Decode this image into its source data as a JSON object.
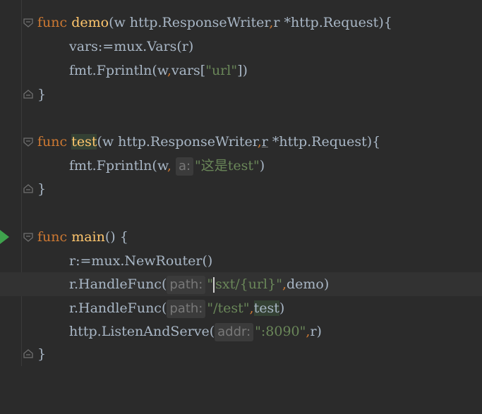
{
  "editor": {
    "lines": {
      "l1": {
        "kw": "func",
        "name": "demo",
        "params_a": "(w http.ResponseWriter",
        "comma": ",",
        "params_b": "r *http.Request){"
      },
      "l2": {
        "text": "vars:=mux.Vars(r)"
      },
      "l3": {
        "pre": "fmt.Fprintln(w",
        "comma": ",",
        "mid": "vars[",
        "str": "\"url\"",
        "post": "])"
      },
      "l4": {
        "text": "}"
      },
      "l6": {
        "kw": "func",
        "name": "test",
        "params_a": "(w http.ResponseWriter",
        "comma": ",",
        "unused": "r",
        "params_b": " *http.Request){"
      },
      "l7": {
        "pre": "fmt.Fprintln(w",
        "comma": ",",
        "hint": "a:",
        "str": "\"这是test\"",
        "post": ")"
      },
      "l8": {
        "text": "}"
      },
      "l10": {
        "kw": "func",
        "name": "main",
        "rest": "() {"
      },
      "l11": {
        "text": "r:=mux.NewRouter()"
      },
      "l12": {
        "pre": "r.HandleFunc(",
        "hint": "path:",
        "str_a": "\"",
        "str_b": "sxt/{url}\"",
        "comma": ",",
        "arg": "demo",
        "post": ")"
      },
      "l13": {
        "pre": "r.HandleFunc(",
        "hint": "path:",
        "str": "\"/test\"",
        "comma": ",",
        "arg": "test",
        "post": ")"
      },
      "l14": {
        "pre": "http.ListenAndServe(",
        "hint": "addr:",
        "str": "\":8090\"",
        "comma": ",",
        "arg": "r",
        "post": ")"
      },
      "l15": {
        "text": "}"
      }
    },
    "icons": {
      "run": "run-gutter-icon",
      "fold": "fold-marker-icon"
    },
    "colors": {
      "background": "#2b2b2b",
      "keyword": "#cc7832",
      "function": "#ffc66d",
      "string": "#6a8759",
      "text": "#a9b7c6",
      "run_icon": "#3fa34d"
    }
  }
}
